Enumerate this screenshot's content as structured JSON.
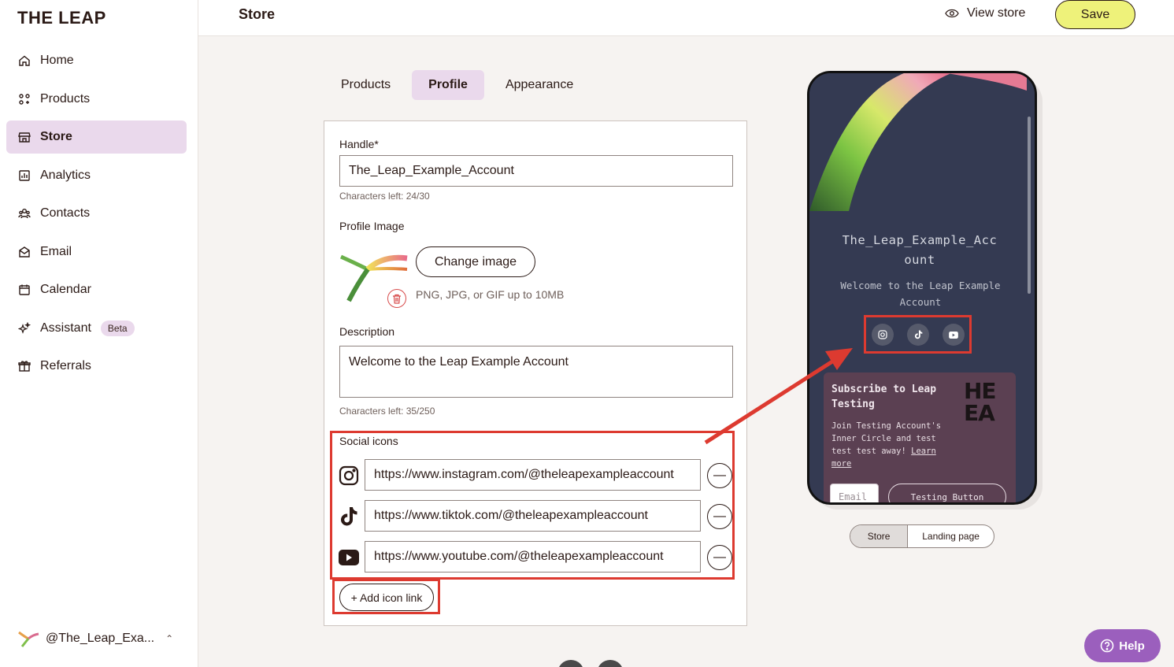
{
  "brand": {
    "logo": "THE LEAP"
  },
  "sidebar": {
    "items": [
      {
        "label": "Home",
        "icon": "home-icon"
      },
      {
        "label": "Products",
        "icon": "products-icon"
      },
      {
        "label": "Store",
        "icon": "store-icon",
        "active": true
      },
      {
        "label": "Analytics",
        "icon": "analytics-icon"
      },
      {
        "label": "Contacts",
        "icon": "contacts-icon"
      },
      {
        "label": "Email",
        "icon": "email-icon"
      },
      {
        "label": "Calendar",
        "icon": "calendar-icon"
      },
      {
        "label": "Assistant",
        "icon": "sparkle-icon",
        "badge": "Beta"
      },
      {
        "label": "Referrals",
        "icon": "gift-icon"
      }
    ],
    "account": "@The_Leap_Exa..."
  },
  "header": {
    "title": "Store",
    "view_store": "View store",
    "save": "Save"
  },
  "tabs": [
    {
      "label": "Products"
    },
    {
      "label": "Profile",
      "active": true
    },
    {
      "label": "Appearance"
    }
  ],
  "form": {
    "handle_label": "Handle*",
    "handle_value": "The_Leap_Example_Account",
    "handle_hint": "Characters left: 24/30",
    "profile_image_label": "Profile Image",
    "change_image": "Change image",
    "image_hint": "PNG, JPG, or GIF up to 10MB",
    "description_label": "Description",
    "description_value": "Welcome to the Leap Example Account",
    "description_hint": "Characters left: 35/250",
    "social_label": "Social icons",
    "social": [
      {
        "icon": "instagram-icon",
        "url": "https://www.instagram.com/@theleapexampleaccount"
      },
      {
        "icon": "tiktok-icon",
        "url": "https://www.tiktok.com/@theleapexampleaccount"
      },
      {
        "icon": "youtube-icon",
        "url": "https://www.youtube.com/@theleapexampleaccount"
      }
    ],
    "add_icon_link": "+ Add icon link"
  },
  "preview": {
    "name_line1": "The_Leap_Example_Acc",
    "name_line2": "ount",
    "desc_line1": "Welcome to the Leap Example",
    "desc_line2": "Account",
    "subscribe_title": "Subscribe to Leap Testing",
    "subscribe_body": "Join Testing Account's Inner Circle and test test test away!",
    "learn_more": "Learn more",
    "sub_logo_line1": "HE",
    "sub_logo_line2": "EA",
    "email_placeholder": "Email",
    "testing_button": "Testing Button",
    "toggle_store": "Store",
    "toggle_landing": "Landing page"
  },
  "help": "Help",
  "colors": {
    "accent": "#ead9ec",
    "save": "#eef27a",
    "annotation": "#dd3a30",
    "help": "#9b5fbd",
    "phone_bg": "#343a52"
  }
}
